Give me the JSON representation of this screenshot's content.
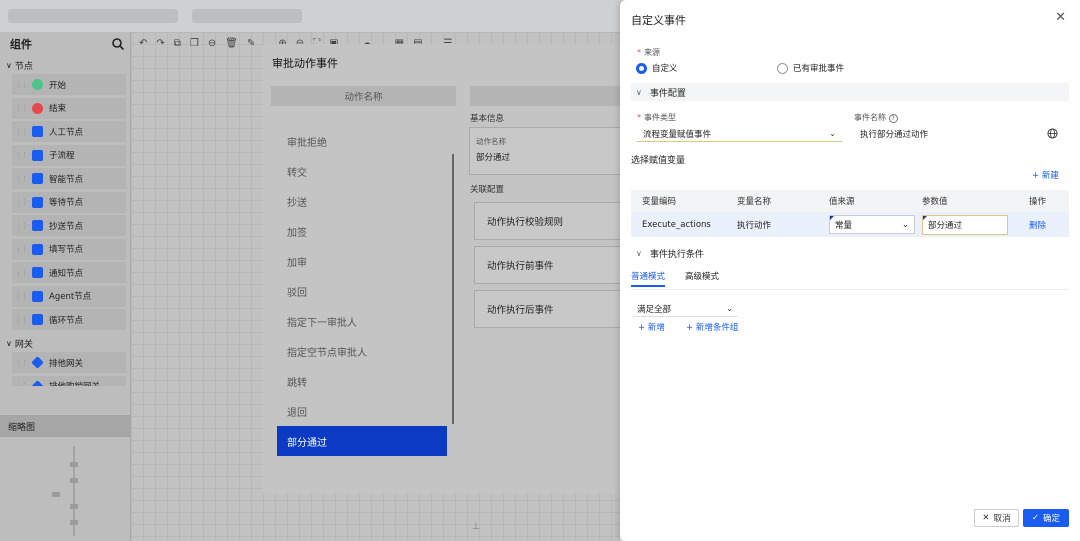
{
  "left_panel": {
    "title": "组件",
    "section_nodes": "节点",
    "nodes": [
      {
        "label": "开始",
        "icon": "start-circle-icon",
        "color": "#4cc38a"
      },
      {
        "label": "结束",
        "icon": "end-circle-icon",
        "color": "#e5484d"
      },
      {
        "label": "人工节点",
        "icon": "user-icon",
        "color": "#1a5cf0"
      },
      {
        "label": "子流程",
        "icon": "subprocess-icon",
        "color": "#1a5cf0"
      },
      {
        "label": "智能节点",
        "icon": "smart-node-icon",
        "color": "#1a5cf0"
      },
      {
        "label": "等待节点",
        "icon": "hourglass-icon",
        "color": "#1a5cf0"
      },
      {
        "label": "抄送节点",
        "icon": "send-icon",
        "color": "#1a5cf0"
      },
      {
        "label": "填写节点",
        "icon": "edit-icon",
        "color": "#1a5cf0"
      },
      {
        "label": "通知节点",
        "icon": "bell-icon",
        "color": "#1a5cf0"
      },
      {
        "label": "Agent节点",
        "icon": "agent-icon",
        "color": "#1a5cf0"
      },
      {
        "label": "循环节点",
        "icon": "loop-icon",
        "color": "#1a5cf0"
      }
    ],
    "section_gateway": "网关",
    "gateways": [
      {
        "label": "排他网关",
        "icon": "exclusive-gateway-icon"
      },
      {
        "label": "排他购销网关",
        "icon": "gateway-icon"
      }
    ],
    "thumbnail_title": "缩略图"
  },
  "dialog": {
    "title": "审批动作事件",
    "column_header": "动作名称",
    "actions": [
      "审批拒绝",
      "转交",
      "抄送",
      "加签",
      "加审",
      "驳回",
      "指定下一审批人",
      "指定空节点审批人",
      "跳转",
      "退回",
      "部分通过"
    ],
    "active_action_index": 10,
    "basic_info_label": "基本信息",
    "action_name_label": "动作名称",
    "action_name_value": "部分通过",
    "related_config_label": "关联配置",
    "configs": [
      "动作执行校验规则",
      "动作执行前事件",
      "动作执行后事件"
    ]
  },
  "drawer": {
    "title": "自定义事件",
    "source_label": "来源",
    "source_options": [
      "自定义",
      "已有审批事件"
    ],
    "source_selected": 0,
    "event_config_section": "事件配置",
    "event_type_label": "事件类型",
    "event_type_value": "流程变量赋值事件",
    "event_name_label": "事件名称",
    "event_name_value": "执行部分通过动作",
    "assign_vars_label": "选择赋值变量",
    "new_link": "+ 新建",
    "table": {
      "headers": [
        "变量编码",
        "变量名称",
        "值来源",
        "参数值",
        "操作"
      ],
      "rows": [
        {
          "code": "Execute_actions",
          "name": "执行动作",
          "source": "常量",
          "value": "部分通过",
          "op": "删除"
        }
      ]
    },
    "condition_section": "事件执行条件",
    "tabs": [
      "普通模式",
      "高级模式"
    ],
    "active_tab": 0,
    "match_value": "满足全部",
    "add_link": "+ 新增",
    "add_group_link": "+ 新增条件组",
    "cancel_label": "取消",
    "ok_label": "确定"
  }
}
